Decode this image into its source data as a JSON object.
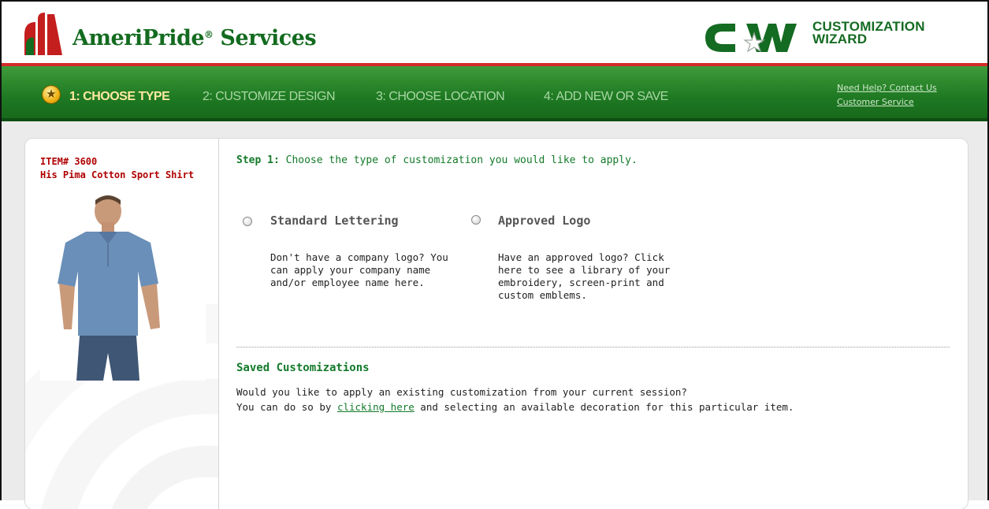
{
  "header": {
    "brand_name": "AmeriPride",
    "brand_reg": "®",
    "brand_suffix": " Services",
    "cw_line1": "CUSTOMIZATION",
    "cw_line2": "WIZARD",
    "logo_icon": "ameripride-logo-icon",
    "cw_icon": "cw-star-logo"
  },
  "nav": {
    "steps": [
      {
        "label": "1: CHOOSE TYPE",
        "state": "active"
      },
      {
        "label": "2: CUSTOMIZE DESIGN",
        "state": "inactive"
      },
      {
        "label": "3: CHOOSE LOCATION",
        "state": "inactive"
      },
      {
        "label": "4: ADD NEW OR SAVE",
        "state": "inactive"
      }
    ],
    "help_link": "Need Help? Contact Us",
    "service_link": "Customer Service"
  },
  "product": {
    "item_number": "ITEM# 3600",
    "name": "His Pima Cotton Sport Shirt",
    "image_icon": "polo-shirt-model-image"
  },
  "step": {
    "prefix": "Step 1:",
    "text": " Choose the type of customization you would like to apply."
  },
  "options": [
    {
      "title": "Standard Lettering",
      "description": "Don't have a company logo? You can apply your company name and/or employee name here."
    },
    {
      "title": "Approved Logo",
      "description": "Have an approved logo? Click here to see a library of your embroidery, screen-print and custom emblems."
    }
  ],
  "saved": {
    "title": "Saved Customizations",
    "line1": "Would you like to apply an existing customization from your current session?",
    "line2_before": "You can do so by ",
    "link": "clicking here",
    "line2_after": " and selecting an available decoration for this particular item."
  },
  "colors": {
    "brand_green": "#136b1f",
    "accent_red": "#d32a2a",
    "nav_green": "#1f7a23",
    "item_red": "#b00000"
  }
}
